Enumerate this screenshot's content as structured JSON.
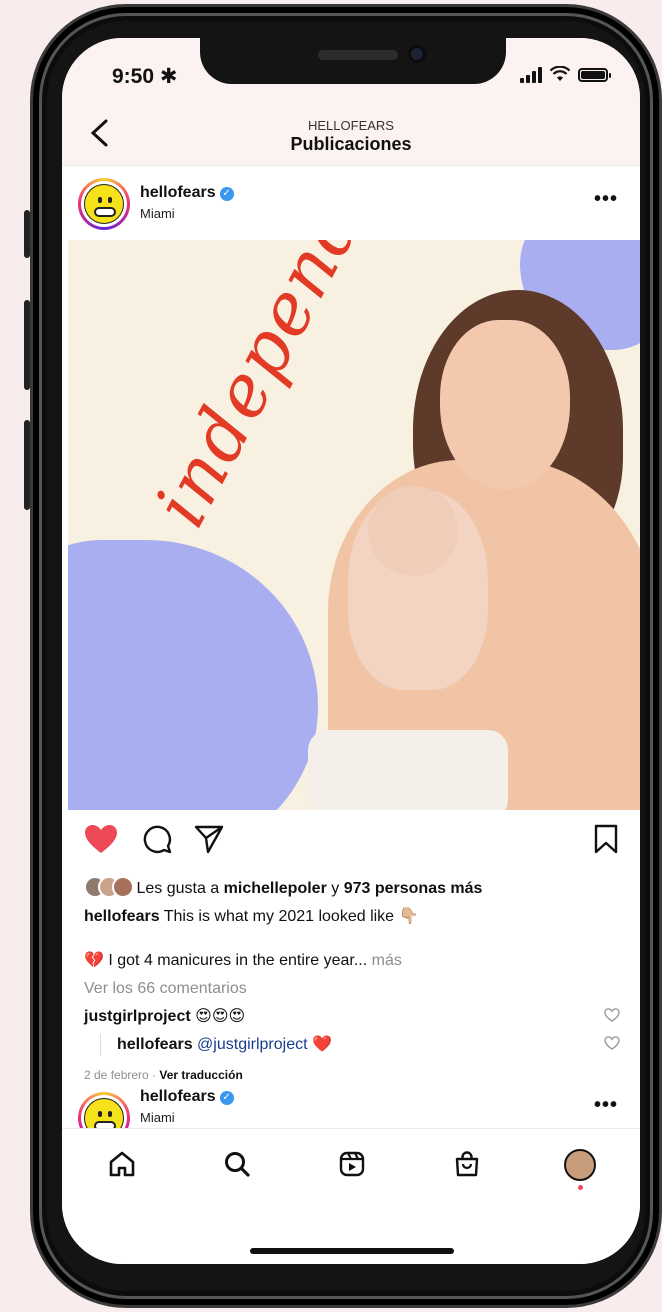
{
  "status_bar": {
    "time": "9:50 ✱",
    "wifi_icon": "wifi-icon",
    "battery_icon": "battery-icon"
  },
  "header": {
    "subtitle": "HELLOFEARS",
    "title": "Publicaciones",
    "back_icon": "‹"
  },
  "post": {
    "username": "hellofears",
    "verified_mark": "✓",
    "location": "Miami",
    "more": "•••",
    "image_text": "independence",
    "likes_prefix": "Les gusta a",
    "likes_user": "michellepoler",
    "likes_conj": "y",
    "likes_others": "973 personas más",
    "caption_user": "hellofears",
    "caption_text": "This is what my 2021 looked like 👇🏼",
    "caption_line2": "💔 I got 4 manicures in the entire year...",
    "caption_more": "más",
    "view_comments": "Ver los 66 comentarios",
    "comment1_user": "justgirlproject",
    "comment1_text": "😍😍😍",
    "reply_user": "hellofears",
    "reply_mention": "@justgirlproject",
    "reply_emoji": "❤️",
    "date": "2 de febrero",
    "dot": "·",
    "translate": "Ver traducción"
  },
  "next_post": {
    "username": "hellofears",
    "location": "Miami",
    "more": "•••"
  },
  "colors": {
    "like_red": "#ed4956",
    "verified_blue": "#3897f0",
    "screen_bg": "#fdf2f2"
  }
}
